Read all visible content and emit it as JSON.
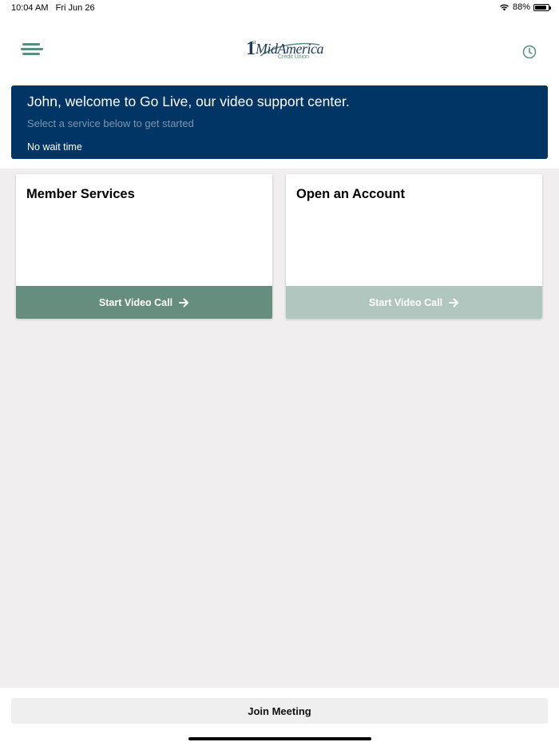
{
  "status_bar": {
    "time": "10:04 AM",
    "date": "Fri Jun 26",
    "battery_percent": "88%",
    "battery_level": 0.88
  },
  "header": {
    "logo": {
      "numeral": "1",
      "ordinal": "st",
      "name": "MidAmerica",
      "subtitle": "Credit Union"
    }
  },
  "banner": {
    "title": "John, welcome to Go Live, our video support center.",
    "subtitle": "Select a service below to get started",
    "wait": "No wait time"
  },
  "services": [
    {
      "title": "Member Services",
      "button_label": "Start Video Call",
      "enabled": true
    },
    {
      "title": "Open an Account",
      "button_label": "Start Video Call",
      "enabled": false
    }
  ],
  "footer": {
    "join_label": "Join Meeting"
  },
  "colors": {
    "brand_navy": "#003566",
    "brand_green": "#658e7e",
    "brand_green_light": "#b2c6c0",
    "background": "#f0eeee"
  }
}
